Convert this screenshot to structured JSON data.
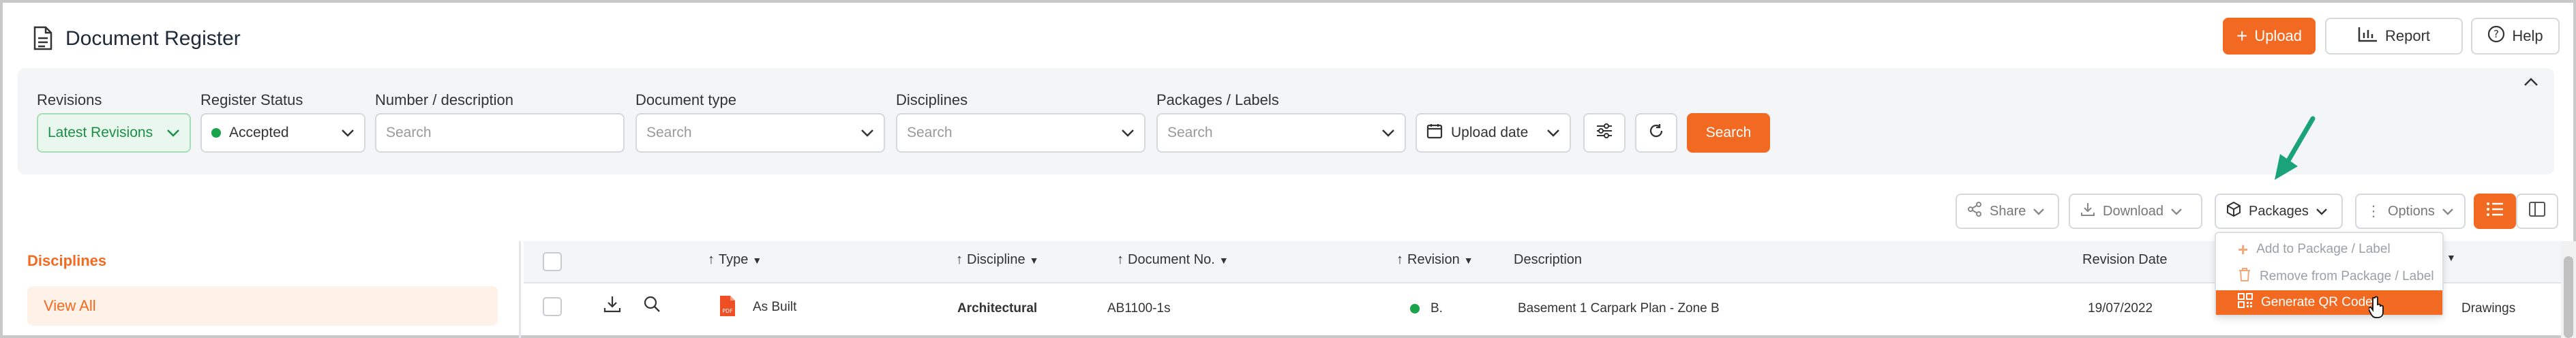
{
  "header": {
    "title": "Document Register",
    "upload_label": "Upload",
    "report_label": "Report",
    "help_label": "Help"
  },
  "filters": {
    "revisions": {
      "label": "Revisions",
      "value": "Latest Revisions"
    },
    "register_status": {
      "label": "Register Status",
      "value": "Accepted"
    },
    "number_description": {
      "label": "Number / description",
      "placeholder": "Search"
    },
    "document_type": {
      "label": "Document type",
      "placeholder": "Search"
    },
    "disciplines": {
      "label": "Disciplines",
      "placeholder": "Search"
    },
    "packages_labels": {
      "label": "Packages / Labels",
      "placeholder": "Search"
    },
    "upload_date_label": "Upload date",
    "search_label": "Search"
  },
  "toolbar": {
    "share_label": "Share",
    "download_label": "Download",
    "packages_label": "Packages",
    "options_label": "Options"
  },
  "packages_menu": {
    "items": [
      {
        "label": "Add to Package / Label"
      },
      {
        "label": "Remove from Package / Label"
      },
      {
        "label": "Generate QR Code"
      }
    ]
  },
  "sidebar": {
    "title": "Disciplines",
    "items": [
      {
        "label": "View All"
      }
    ]
  },
  "table": {
    "columns": {
      "type": "Type",
      "discipline": "Discipline",
      "document_no": "Document No.",
      "revision": "Revision",
      "description": "Description",
      "revision_date": "Revision Date"
    },
    "rows": [
      {
        "type": "As Built",
        "discipline": "Architectural",
        "document_no": "AB1100-1s",
        "revision": "B.",
        "description": "Basement 1 Carpark Plan - Zone B",
        "revision_date": "19/07/2022",
        "package": "Drawings"
      }
    ]
  },
  "colors": {
    "accent": "#f26a21",
    "accepted": "#1aa34a",
    "pointer_arrow": "#1aa37a"
  }
}
